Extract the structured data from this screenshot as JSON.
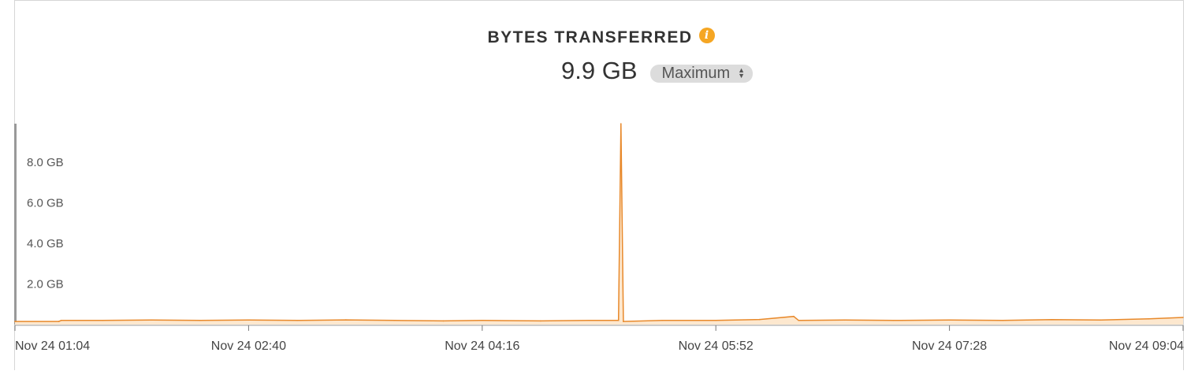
{
  "title": "BYTES TRANSFERRED",
  "info_icon": "info-icon",
  "total_value": "9.9 GB",
  "aggregation": {
    "selected": "Maximum",
    "icon": "select-arrows-icon"
  },
  "colors": {
    "line": "#e8892b",
    "fill": "#fde8cf",
    "accent": "#f5a623"
  },
  "chart_data": {
    "type": "area",
    "title": "BYTES TRANSFERRED",
    "y_unit": "GB",
    "ylim": [
      0,
      9.9
    ],
    "y_ticks": [
      "2.0 GB",
      "4.0 GB",
      "6.0 GB",
      "8.0 GB"
    ],
    "y_tick_values": [
      2.0,
      4.0,
      6.0,
      8.0
    ],
    "x_ticks": [
      "Nov 24 01:04",
      "Nov 24 02:40",
      "Nov 24 04:16",
      "Nov 24 05:52",
      "Nov 24 07:28",
      "Nov 24 09:04"
    ],
    "x_range": [
      "Nov 24 01:04",
      "Nov 24 09:04"
    ],
    "grid": false,
    "series": [
      {
        "points": [
          [
            "Nov 24 01:04",
            0.15
          ],
          [
            "Nov 24 01:22",
            0.15
          ],
          [
            "Nov 24 01:23",
            0.2
          ],
          [
            "Nov 24 01:40",
            0.2
          ],
          [
            "Nov 24 02:00",
            0.22
          ],
          [
            "Nov 24 02:20",
            0.2
          ],
          [
            "Nov 24 02:40",
            0.22
          ],
          [
            "Nov 24 03:00",
            0.2
          ],
          [
            "Nov 24 03:20",
            0.23
          ],
          [
            "Nov 24 03:40",
            0.2
          ],
          [
            "Nov 24 04:00",
            0.18
          ],
          [
            "Nov 24 04:16",
            0.2
          ],
          [
            "Nov 24 04:40",
            0.18
          ],
          [
            "Nov 24 05:00",
            0.2
          ],
          [
            "Nov 24 05:12",
            0.2
          ],
          [
            "Nov 24 05:13",
            9.9
          ],
          [
            "Nov 24 05:14",
            0.15
          ],
          [
            "Nov 24 05:30",
            0.2
          ],
          [
            "Nov 24 05:52",
            0.2
          ],
          [
            "Nov 24 06:10",
            0.25
          ],
          [
            "Nov 24 06:24",
            0.4
          ],
          [
            "Nov 24 06:26",
            0.2
          ],
          [
            "Nov 24 06:45",
            0.22
          ],
          [
            "Nov 24 07:05",
            0.2
          ],
          [
            "Nov 24 07:28",
            0.22
          ],
          [
            "Nov 24 07:50",
            0.2
          ],
          [
            "Nov 24 08:10",
            0.24
          ],
          [
            "Nov 24 08:30",
            0.22
          ],
          [
            "Nov 24 08:50",
            0.28
          ],
          [
            "Nov 24 09:04",
            0.35
          ]
        ]
      }
    ]
  }
}
